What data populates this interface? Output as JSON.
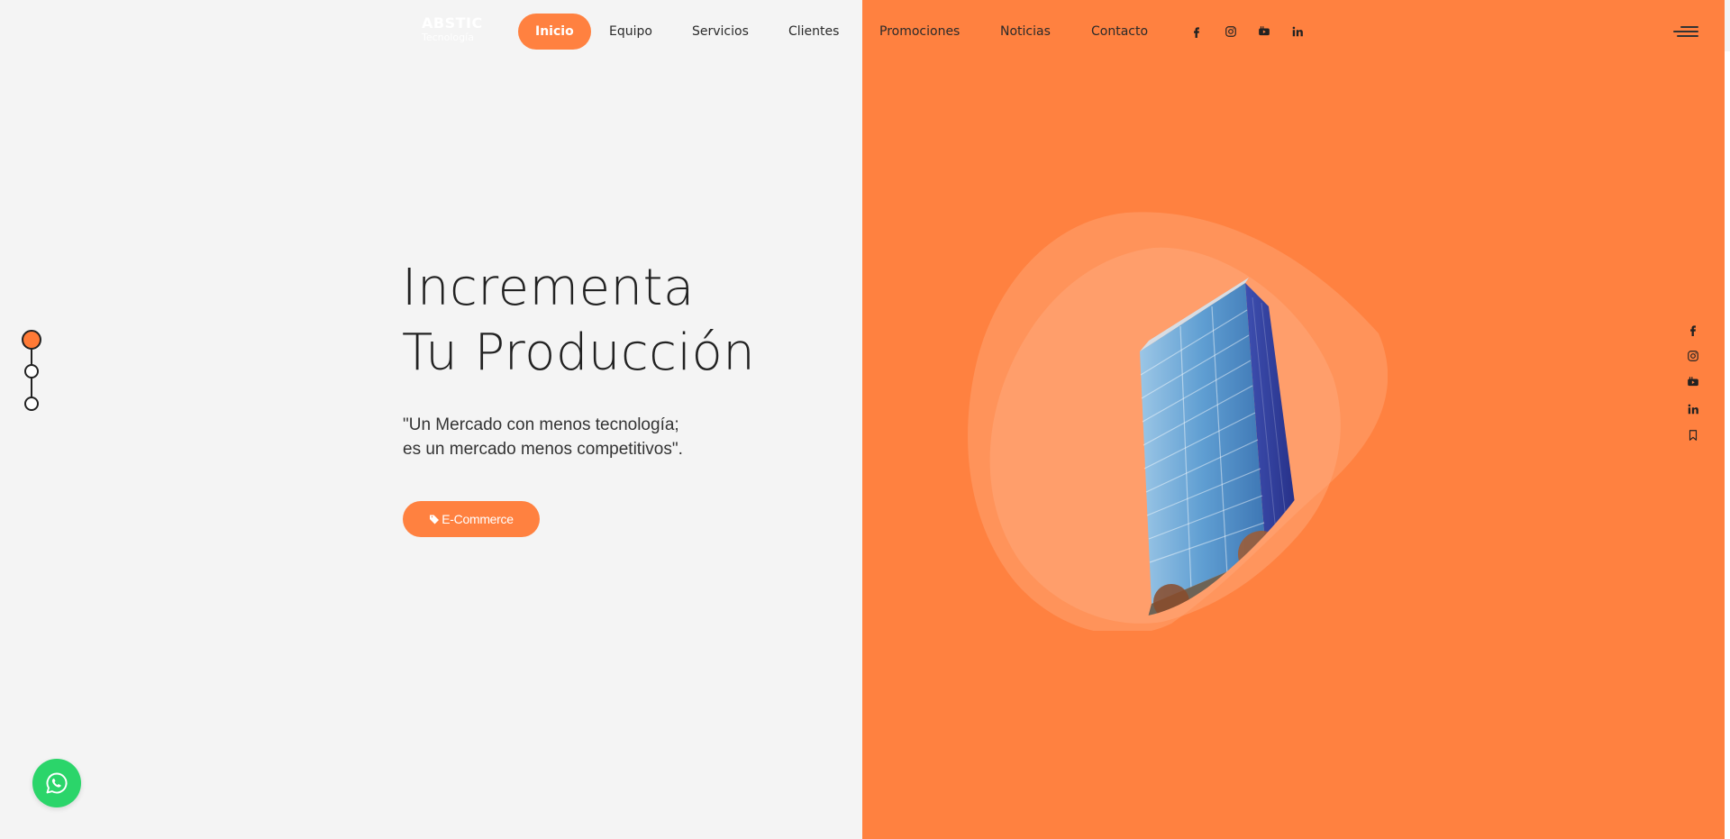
{
  "brand": {
    "name_line1": "ABSTIC",
    "name_line2": "Tecnología"
  },
  "nav": {
    "items": [
      {
        "label": "Inicio",
        "active": true
      },
      {
        "label": "Equipo"
      },
      {
        "label": "Servicios"
      },
      {
        "label": "Clientes"
      },
      {
        "label": "Promociones"
      },
      {
        "label": "Noticias"
      },
      {
        "label": "Contacto"
      }
    ],
    "social_icons": [
      "facebook-icon",
      "instagram-icon",
      "youtube-icon",
      "linkedin-icon"
    ]
  },
  "hero": {
    "title_line1": "Incrementa",
    "title_line2": "Tu Producción",
    "quote_line1": "\"Un Mercado con menos tecnología;",
    "quote_line2": "es un mercado menos competitivos\".",
    "cta_label": "E-Commerce",
    "cta_icon": "tag-icon"
  },
  "pager": {
    "count": 3,
    "active_index": 0
  },
  "side_social": [
    "facebook-icon",
    "instagram-icon",
    "youtube-icon",
    "linkedin-icon",
    "bookmark-icon"
  ],
  "floating": {
    "icon": "whatsapp-icon"
  },
  "colors": {
    "accent": "#ff8140",
    "left_background": "#f4f4f4",
    "whatsapp_green": "#2bd56a",
    "text_dark": "#222222"
  }
}
